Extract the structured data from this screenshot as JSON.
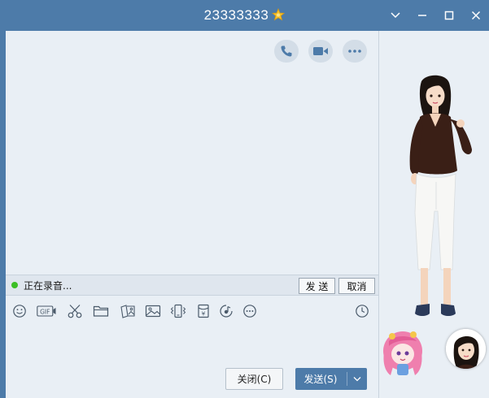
{
  "window": {
    "title": "23333333",
    "title_badge_icon": "gold-star-icon",
    "controls": [
      "chevron-down-icon",
      "minimize-icon",
      "maximize-icon",
      "close-icon"
    ],
    "accent_color": "#4d7ba9",
    "background_color": "#e9eff5"
  },
  "chat_header": {
    "actions": [
      "phone-icon",
      "video-camera-icon",
      "more-icon"
    ]
  },
  "recording_bar": {
    "status_text": "正在录音...",
    "status_color": "#3cbf26",
    "send_label": "发 送",
    "cancel_label": "取消"
  },
  "toolbar": {
    "tools": [
      "emoji-icon",
      "gif-icon",
      "scissors-icon",
      "folder-icon",
      "image-gallery-icon",
      "picture-icon",
      "shake-icon",
      "red-packet-icon",
      "music-icon",
      "more-circle-icon",
      "clock-icon"
    ],
    "gif_text": "GIF",
    "red_packet_text": "¥"
  },
  "footer": {
    "close_label": "关闭(C)",
    "send_label": "发送(S)"
  },
  "side_panel": {
    "avatar_icon": "avatar",
    "show_icon": "girl-figure",
    "sticker_icon": "anime-sticker"
  }
}
